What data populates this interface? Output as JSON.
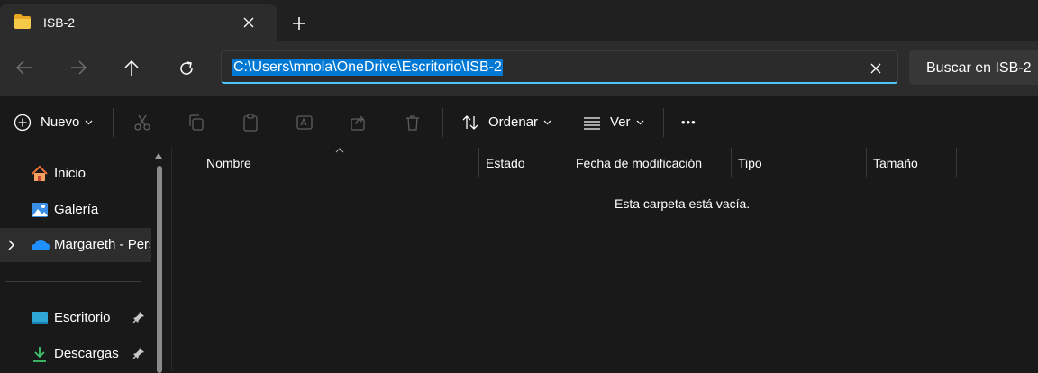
{
  "tab": {
    "title": "ISB-2",
    "icon": "folder-icon"
  },
  "nav": {
    "address": "C:\\Users\\mnola\\OneDrive\\Escritorio\\ISB-2",
    "search_placeholder": "Buscar en ISB-2"
  },
  "commands": {
    "new_label": "Nuevo",
    "sort_label": "Ordenar",
    "view_label": "Ver",
    "more_label": "•••"
  },
  "sidebar": {
    "items": [
      {
        "label": "Inicio",
        "icon": "home-icon"
      },
      {
        "label": "Galería",
        "icon": "gallery-icon"
      },
      {
        "label": "Margareth - Personal",
        "icon": "onedrive-cloud-icon",
        "selected": true
      },
      {
        "label": "Escritorio",
        "icon": "desktop-icon",
        "pinned": true
      },
      {
        "label": "Descargas",
        "icon": "downloads-icon",
        "pinned": true
      }
    ]
  },
  "list": {
    "columns": [
      "Nombre",
      "Estado",
      "Fecha de modificación",
      "Tipo",
      "Tamaño"
    ],
    "empty_message": "Esta carpeta está vacía."
  },
  "colors": {
    "background": "#191919",
    "toolbar": "#2c2c2c",
    "accent": "#4cc2ff",
    "selection": "#0078d4",
    "folder": "#f2c14e"
  }
}
